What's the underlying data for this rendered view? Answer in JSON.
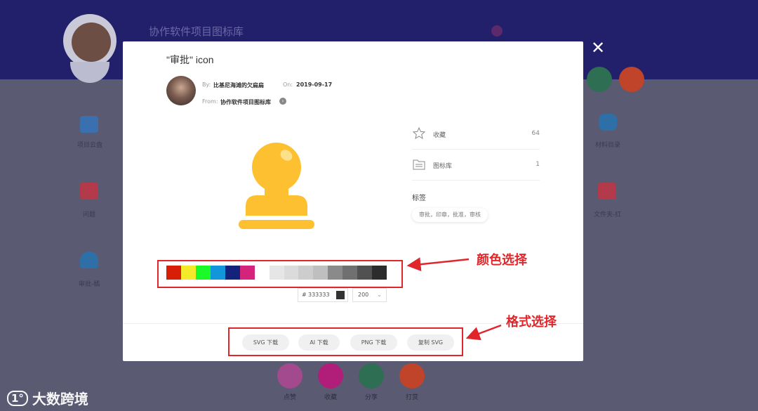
{
  "background": {
    "library_title": "协作软件项目图标库",
    "side_items": [
      {
        "label": "项目云盘",
        "icon": "drive-icon",
        "color": "#3a6fb0"
      },
      {
        "label": "问题",
        "icon": "chat-icon",
        "color": "#b23a4a"
      },
      {
        "label": "审批-橘",
        "icon": "user-icon",
        "color": "#2f6fa8"
      },
      {
        "label": "材料目录",
        "icon": "database-icon",
        "color": "#2f6fa8"
      },
      {
        "label": "文件夹-红",
        "icon": "folder-icon",
        "color": "#b23a4a"
      }
    ],
    "actions": [
      {
        "label": "点赞",
        "icon": "like-icon",
        "color": "#a34a8e"
      },
      {
        "label": "收藏",
        "icon": "heart-icon",
        "color": "#b01e7a"
      },
      {
        "label": "分享",
        "icon": "share-icon",
        "color": "#2e6e52"
      },
      {
        "label": "打赏",
        "icon": "reward-icon",
        "color": "#c0442a"
      }
    ]
  },
  "modal": {
    "title": "\"审批\" icon",
    "author": {
      "by_label": "By:",
      "name": "比基尼海滩的欠扁扁",
      "on_label": "On:",
      "date": "2019-09-17",
      "from_label": "From:",
      "library": "协作软件项目图标库"
    },
    "stats": [
      {
        "label": "收藏",
        "count": "64",
        "icon": "star-icon"
      },
      {
        "label": "图标库",
        "count": "1",
        "icon": "library-icon"
      }
    ],
    "tags_title": "标签",
    "tags": "审批，印章，批准，审核",
    "colors": [
      "#d81e06",
      "#f4ea2a",
      "#1afa29",
      "#1296db",
      "#13227a",
      "#d4237a",
      "#ffffff",
      "#e6e6e6",
      "#dbdbdb",
      "#cdcdcd",
      "#bfbfbf",
      "#8a8a8a",
      "#707070",
      "#515151",
      "#2c2c2c"
    ],
    "hex_prefix": "#",
    "hex_value": "333333",
    "size_value": "200",
    "formats": [
      "SVG 下载",
      "AI 下载",
      "PNG 下载",
      "复制 SVG"
    ]
  },
  "annotations": {
    "color_label": "颜色选择",
    "format_label": "格式选择"
  },
  "watermark": {
    "logo_text": "1°",
    "brand": "大数跨境"
  }
}
